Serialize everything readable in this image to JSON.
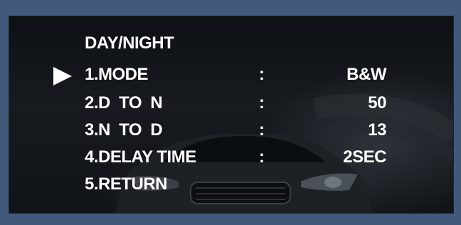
{
  "menu": {
    "title": "DAY/NIGHT",
    "items": [
      {
        "label": "1.MODE",
        "colon": ":",
        "value": "B&W",
        "selected": true
      },
      {
        "label": "2.D  TO  N",
        "colon": ":",
        "value": "50"
      },
      {
        "label": "3.N  TO  D",
        "colon": ":",
        "value": "13"
      },
      {
        "label": "4.DELAY TIME",
        "colon": ":",
        "value": "2SEC"
      },
      {
        "label": "5.RETURN"
      }
    ]
  },
  "colors": {
    "frame": "#43597b",
    "text": "#ffffff"
  },
  "icons": {
    "cursor": "right-triangle-icon"
  }
}
